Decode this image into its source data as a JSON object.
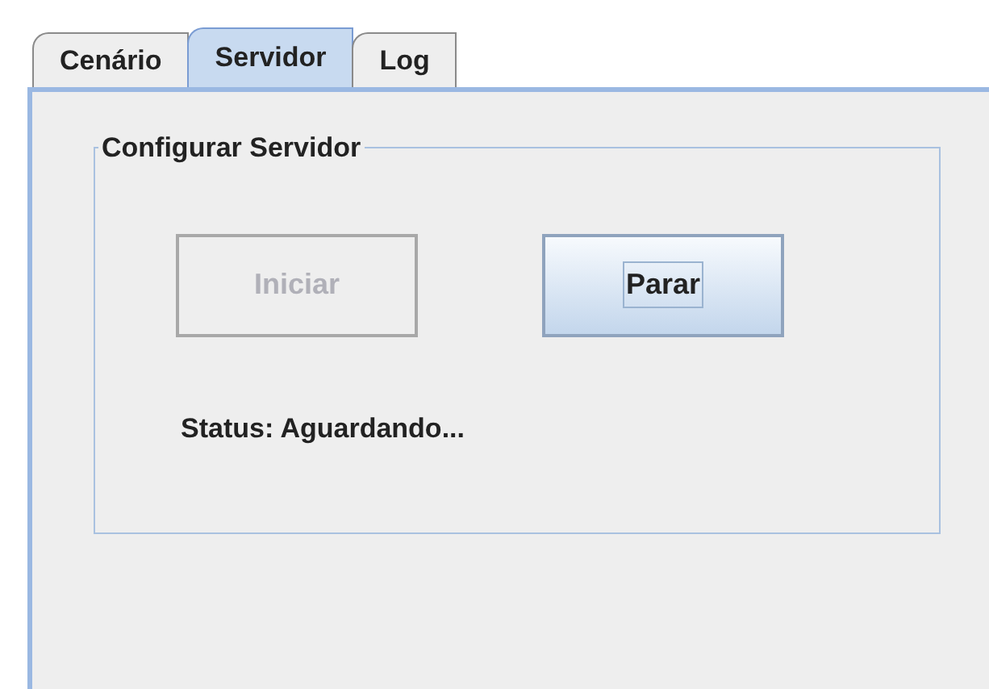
{
  "tabs": [
    {
      "label": "Cenário",
      "selected": false
    },
    {
      "label": "Servidor",
      "selected": true
    },
    {
      "label": "Log",
      "selected": false
    }
  ],
  "group": {
    "title": "Configurar Servidor",
    "buttons": [
      {
        "label": "Iniciar",
        "disabled": true,
        "focused": false
      },
      {
        "label": "Parar",
        "disabled": false,
        "focused": true
      }
    ],
    "status": "Status: Aguardando..."
  }
}
